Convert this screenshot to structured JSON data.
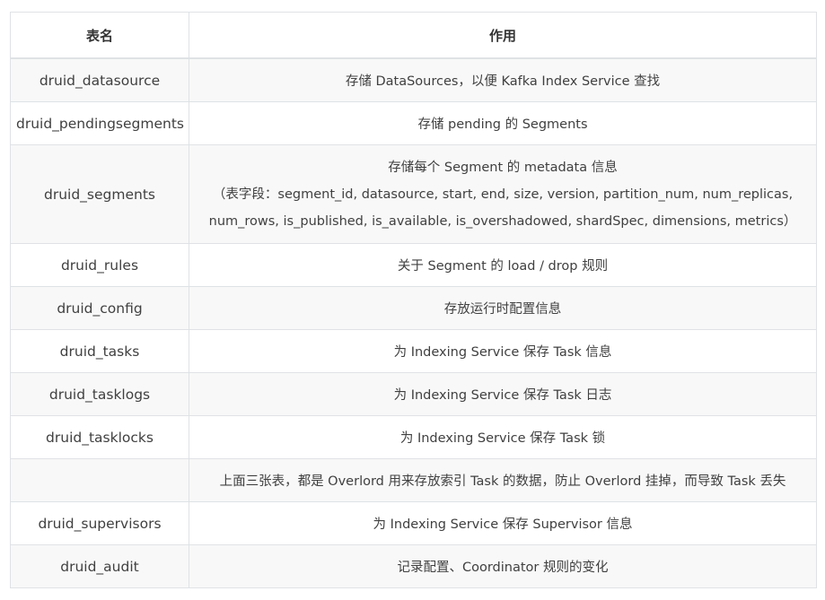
{
  "table": {
    "headers": {
      "name": "表名",
      "purpose": "作用"
    },
    "rows": [
      {
        "name": "druid_datasource",
        "purpose": "存储 DataSources，以便 Kafka Index Service 查找"
      },
      {
        "name": "druid_pendingsegments",
        "purpose": "存储 pending 的 Segments"
      },
      {
        "name": "druid_segments",
        "purpose_lines": [
          "存储每个 Segment 的 metadata 信息",
          "（表字段：segment_id, datasource, start, end, size, version, partition_num, num_replicas,",
          "num_rows, is_published, is_available, is_overshadowed, shardSpec, dimensions, metrics）"
        ]
      },
      {
        "name": "druid_rules",
        "purpose": "关于 Segment 的 load / drop 规则"
      },
      {
        "name": "druid_config",
        "purpose": "存放运行时配置信息"
      },
      {
        "name": "druid_tasks",
        "purpose": "为 Indexing Service 保存 Task 信息"
      },
      {
        "name": "druid_tasklogs",
        "purpose": "为 Indexing Service 保存 Task 日志"
      },
      {
        "name": "druid_tasklocks",
        "purpose": "为 Indexing Service 保存 Task 锁"
      },
      {
        "name": "",
        "purpose": "上面三张表，都是 Overlord 用来存放索引 Task 的数据，防止 Overlord 挂掉，而导致 Task 丢失"
      },
      {
        "name": "druid_supervisors",
        "purpose": "为 Indexing Service 保存 Supervisor 信息"
      },
      {
        "name": "druid_audit",
        "purpose": "记录配置、Coordinator 规则的变化"
      }
    ]
  }
}
